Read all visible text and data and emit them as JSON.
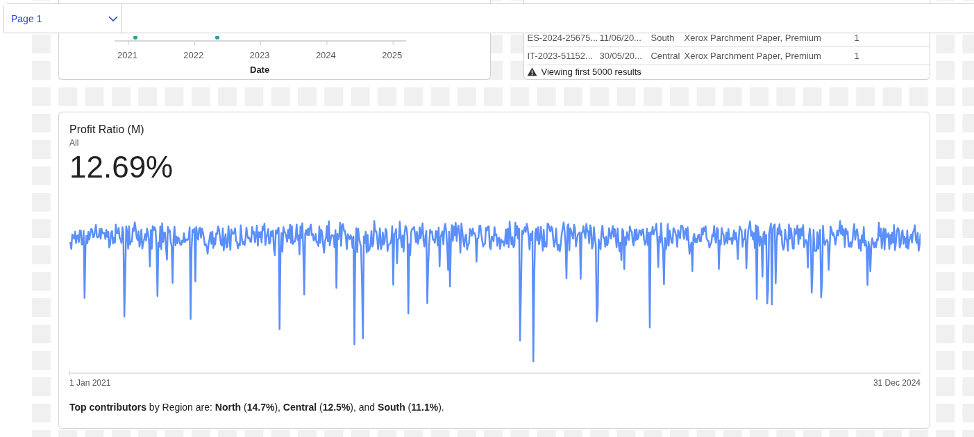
{
  "page_selector": {
    "label": "Page 1"
  },
  "date_chart": {
    "x_ticks": [
      "2021",
      "2022",
      "2023",
      "2024",
      "2025"
    ],
    "x_axis_title": "Date"
  },
  "orders_table": {
    "rows": [
      {
        "column_1": "ES-2024-25675...",
        "column_2": "11/06/20...",
        "column_3": "South",
        "column_4": "Xerox Parchment Paper, Premium",
        "column_5": "1"
      },
      {
        "column_1": "IT-2023-51152...",
        "column_2": "30/05/20...",
        "column_3": "Central",
        "column_4": "Xerox Parchment Paper, Premium",
        "column_5": "1"
      }
    ],
    "notice": "Viewing first 5000 results"
  },
  "metric_card": {
    "title": "Profit Ratio (M)",
    "filter": "All",
    "value": "12.69%",
    "start_label": "1 Jan 2021",
    "end_label": "31 Dec 2024",
    "summary": "**Top contributors** by Region are: **North** (**14.7%**), **Central** (**12.5%**), and **South** (**11.1%**)."
  }
}
